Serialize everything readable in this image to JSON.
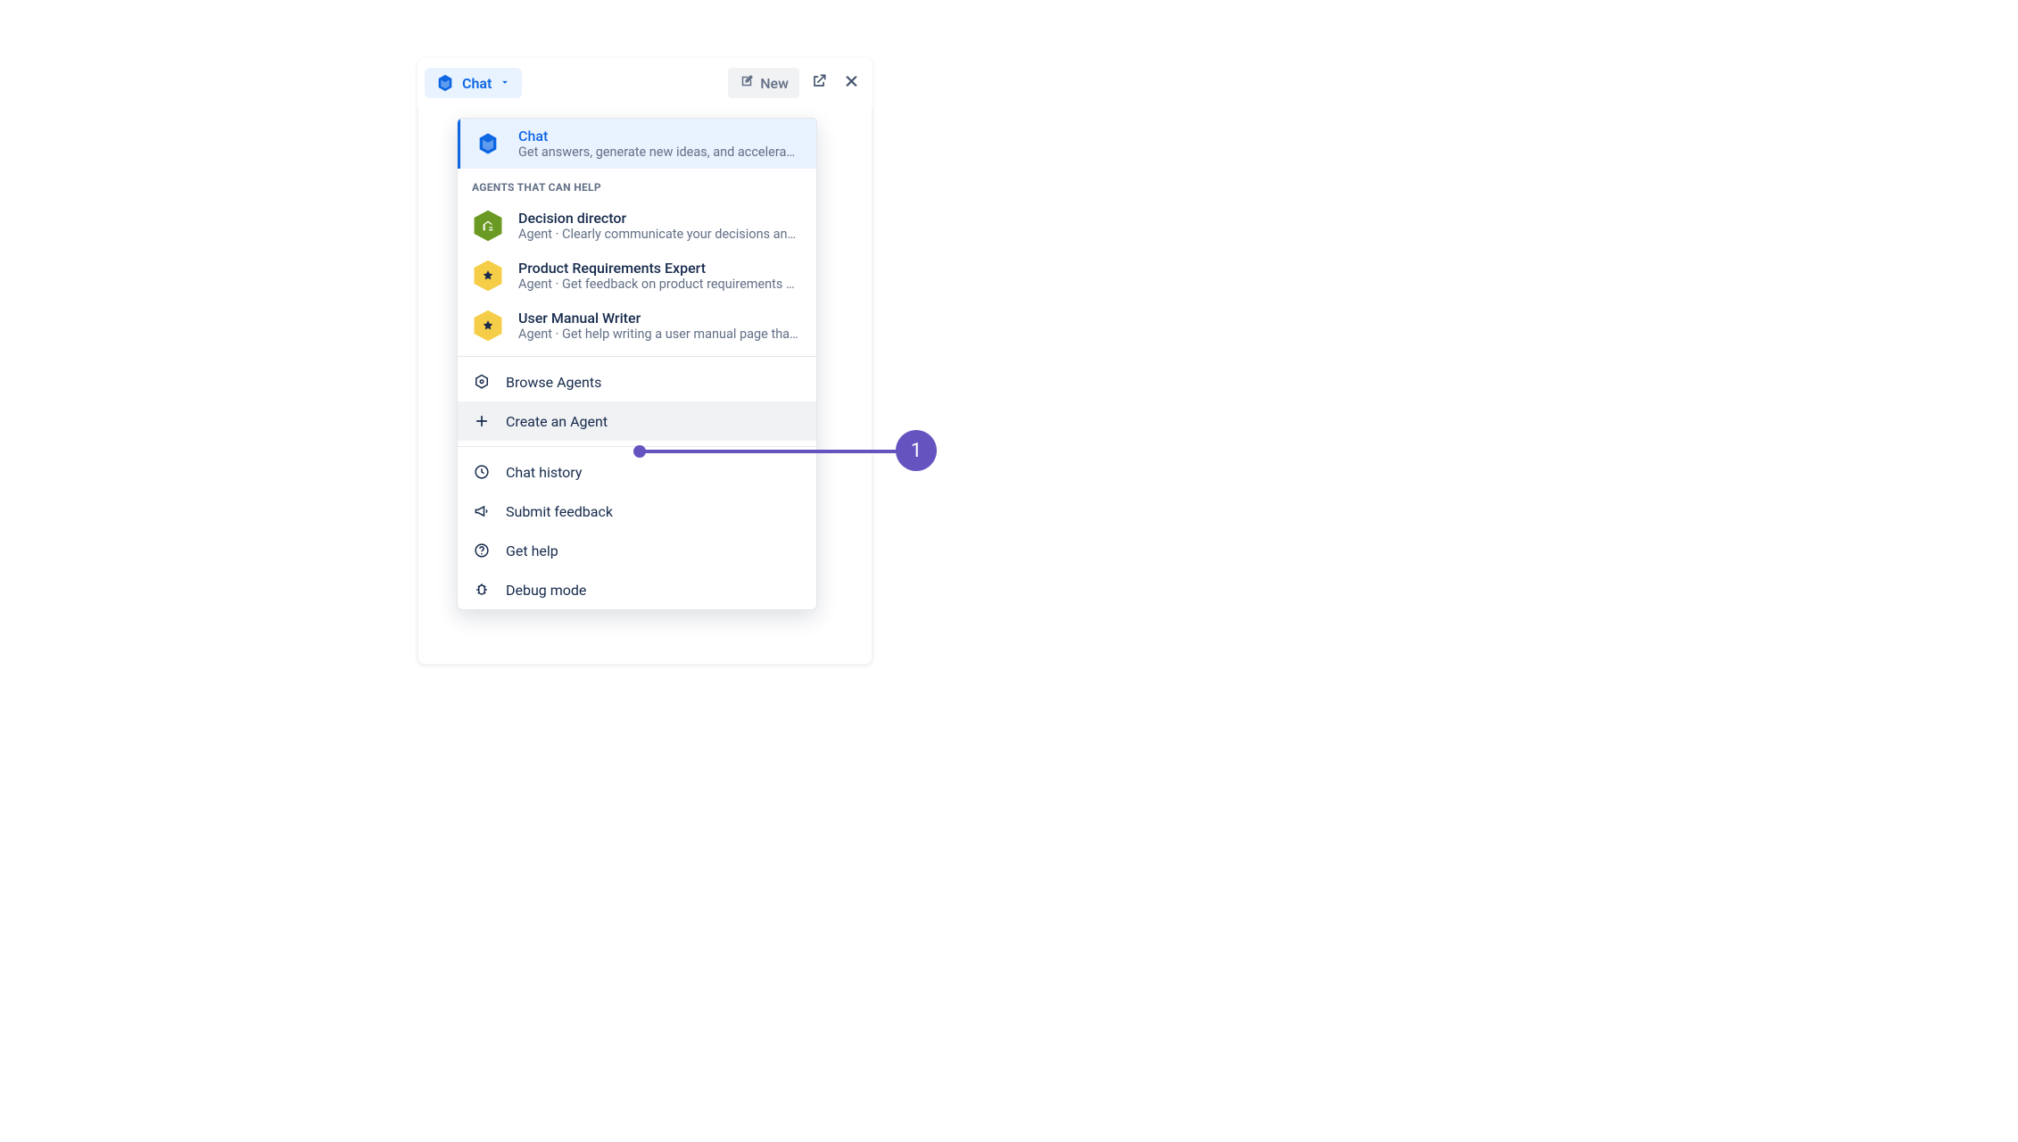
{
  "header": {
    "chip_label": "Chat",
    "new_label": "New"
  },
  "dropdown": {
    "selected": {
      "title": "Chat",
      "subtitle": "Get answers, generate new ideas, and accelera…"
    },
    "section_label": "AGENTS THAT CAN HELP",
    "agents": [
      {
        "title": "Decision director",
        "subtitle": "Agent · Clearly communicate your decisions an…",
        "color": "green"
      },
      {
        "title": "Product Requirements Expert",
        "subtitle": "Agent · Get feedback on product requirements …",
        "color": "amber"
      },
      {
        "title": "User Manual Writer",
        "subtitle": "Agent · Get help writing a user manual page tha…",
        "color": "amber"
      }
    ],
    "actions": {
      "browse": "Browse Agents",
      "create": "Create an Agent"
    },
    "footer": {
      "history": "Chat history",
      "feedback": "Submit feedback",
      "help": "Get help",
      "debug": "Debug mode"
    }
  },
  "callout": {
    "number": "1"
  }
}
